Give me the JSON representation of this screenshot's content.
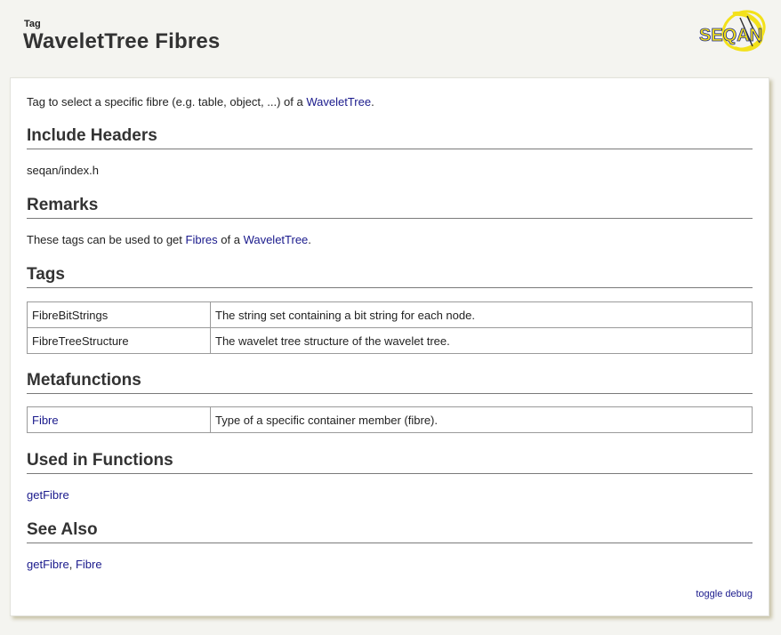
{
  "header": {
    "kind": "Tag",
    "title": "WaveletTree Fibres",
    "logo_text": "SEQAN"
  },
  "intro": {
    "prefix": "Tag to select a specific fibre (e.g. table, object, ...) of a ",
    "link": "WaveletTree",
    "suffix": "."
  },
  "sections": {
    "include_headers": {
      "heading": "Include Headers",
      "text": "seqan/index.h"
    },
    "remarks": {
      "heading": "Remarks",
      "prefix": "These tags can be used to get ",
      "link1": "Fibres",
      "middle": " of a ",
      "link2": "WaveletTree",
      "suffix": "."
    },
    "tags": {
      "heading": "Tags",
      "rows": [
        {
          "name": "FibreBitStrings",
          "desc": "The string set containing a bit string for each node."
        },
        {
          "name": "FibreTreeStructure",
          "desc": "The wavelet tree structure of the wavelet tree."
        }
      ]
    },
    "metafunctions": {
      "heading": "Metafunctions",
      "rows": [
        {
          "name": "Fibre",
          "desc": "Type of a specific container member (fibre)."
        }
      ]
    },
    "used_in_functions": {
      "heading": "Used in Functions",
      "link": "getFibre"
    },
    "see_also": {
      "heading": "See Also",
      "link1": "getFibre",
      "separator": ", ",
      "link2": "Fibre"
    }
  },
  "footer": {
    "toggle_debug": "toggle debug"
  },
  "colors": {
    "link": "#1a1a8c",
    "background": "#f4f4f0",
    "logo_blue": "#1f2a8c",
    "logo_yellow": "#f3e11a"
  }
}
